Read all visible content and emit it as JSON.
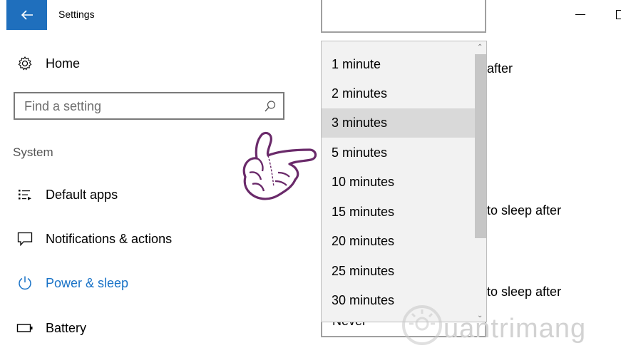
{
  "window": {
    "title": "Settings",
    "back_icon": "back-arrow-icon"
  },
  "sidebar": {
    "home": {
      "label": "Home",
      "icon": "gear-icon"
    },
    "search": {
      "placeholder": "Find a setting",
      "icon": "search-icon"
    },
    "section": "System",
    "items": [
      {
        "label": "Default apps",
        "icon": "default-apps-icon",
        "active": false
      },
      {
        "label": "Notifications & actions",
        "icon": "notifications-icon",
        "active": false
      },
      {
        "label": "Power & sleep",
        "icon": "power-icon",
        "active": true
      },
      {
        "label": "Battery",
        "icon": "battery-icon",
        "active": false
      }
    ],
    "accent_color": "#1a73c7"
  },
  "background_content": {
    "line1": "after",
    "line2": "to sleep after",
    "line3": "to sleep after",
    "bottom_combo_value": "Never"
  },
  "dropdown": {
    "options": [
      "1 minute",
      "2 minutes",
      "3 minutes",
      "5 minutes",
      "10 minutes",
      "15 minutes",
      "20 minutes",
      "25 minutes",
      "30 minutes"
    ],
    "highlighted": "3 minutes"
  },
  "watermark": {
    "text": "uantrimang"
  }
}
